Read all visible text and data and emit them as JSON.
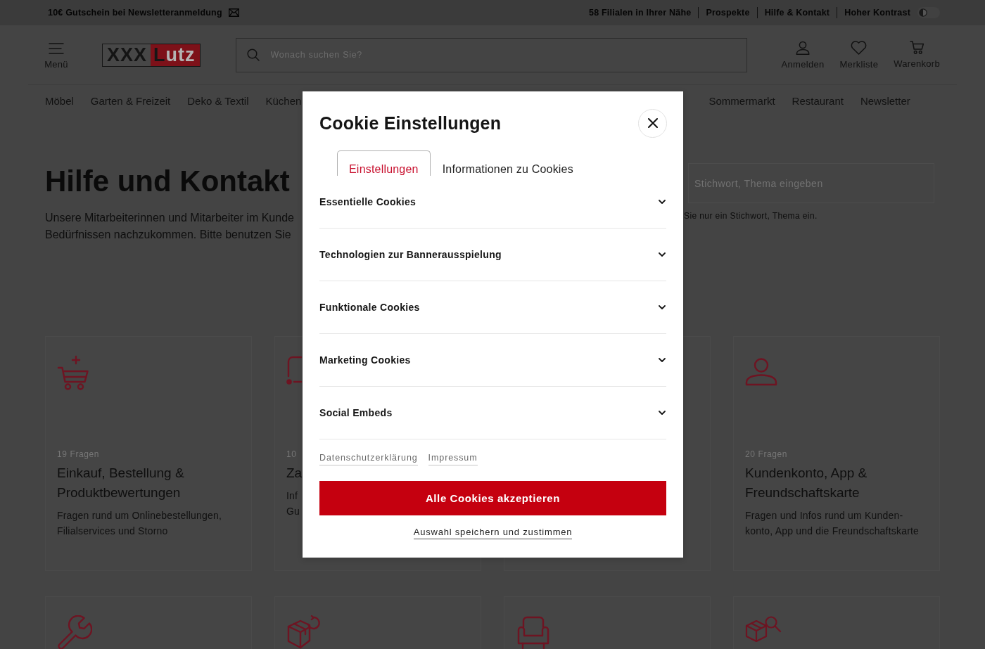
{
  "top_bar": {
    "promo": "10€ Gutschein bei Newsletteranmeldung",
    "links": [
      "58 Filialen in Ihrer Nähe",
      "Prospekte",
      "Hilfe & Kontakt"
    ],
    "contrast_toggle": {
      "label": "Hoher Kontrast",
      "on": false
    }
  },
  "header": {
    "menu_label": "Menü",
    "logo": {
      "boxed_text": "XXX",
      "highlighted_text": "Lutz"
    },
    "search": {
      "placeholder": "Wonach suchen Sie?"
    },
    "actions": [
      {
        "kind": "account",
        "label": "Anmelden"
      },
      {
        "kind": "wishlist",
        "label": "Merkliste"
      },
      {
        "kind": "cart",
        "label": "Warenkorb"
      }
    ]
  },
  "category_nav": [
    "Möbel",
    "Garten & Freizeit",
    "Deko & Textil",
    "Küchen",
    "Sommermarkt",
    "Restaurant",
    "Newsletter"
  ],
  "help_page": {
    "title": "Hilfe und Kontakt",
    "intro_lines": [
      "Unsere Mitarbeiterinnen und Mitarbeiter im Kunde",
      "Bedürfnissen nachzukommen. Bitte benutzen Sie"
    ],
    "faq_search": {
      "placeholder": "Stichwort, Thema eingeben",
      "hint": "Sie nur ein Stichwort, Thema ein."
    },
    "topic_cards": [
      {
        "kind": "orders",
        "count": "19 Fragen",
        "title": "Einkauf, Bestellung & Produktbewertungen",
        "description": "Fragen rund um Onlinebestellungen, Filialservices und Storno"
      },
      {
        "kind": "partial",
        "count": "10",
        "title": "Za",
        "description_lines": [
          "Inf",
          "Gu"
        ]
      },
      {
        "kind": "covered"
      },
      {
        "kind": "account",
        "count": "20 Fragen",
        "title": "Kundenkonto, App & Freundschaftskarte",
        "description": "Fragen und Infos rund um Kunden-konto, App und die Freundschaftskarte"
      },
      {
        "kind": "repair"
      },
      {
        "kind": "returns"
      },
      {
        "kind": "furniture"
      },
      {
        "kind": "parcel_search"
      }
    ]
  },
  "cookie_dialog": {
    "title": "Cookie Einstellungen",
    "tabs": [
      {
        "label": "Einstellungen",
        "selected": true
      },
      {
        "label": "Informationen zu Cookies",
        "selected": false
      }
    ],
    "categories": [
      {
        "label": "Essentielle Cookies",
        "expanded": false
      },
      {
        "label": "Technologien zur Bannerausspielung",
        "expanded": false
      },
      {
        "label": "Funktionale Cookies",
        "expanded": false
      },
      {
        "label": "Marketing Cookies",
        "expanded": false
      },
      {
        "label": "Social Embeds",
        "expanded": false
      }
    ],
    "links": [
      "Datenschutzerklärung",
      "Impressum"
    ],
    "accept_all_button": "Alle Cookies akzeptieren",
    "save_link": "Auswahl speichern und zustimmen"
  }
}
